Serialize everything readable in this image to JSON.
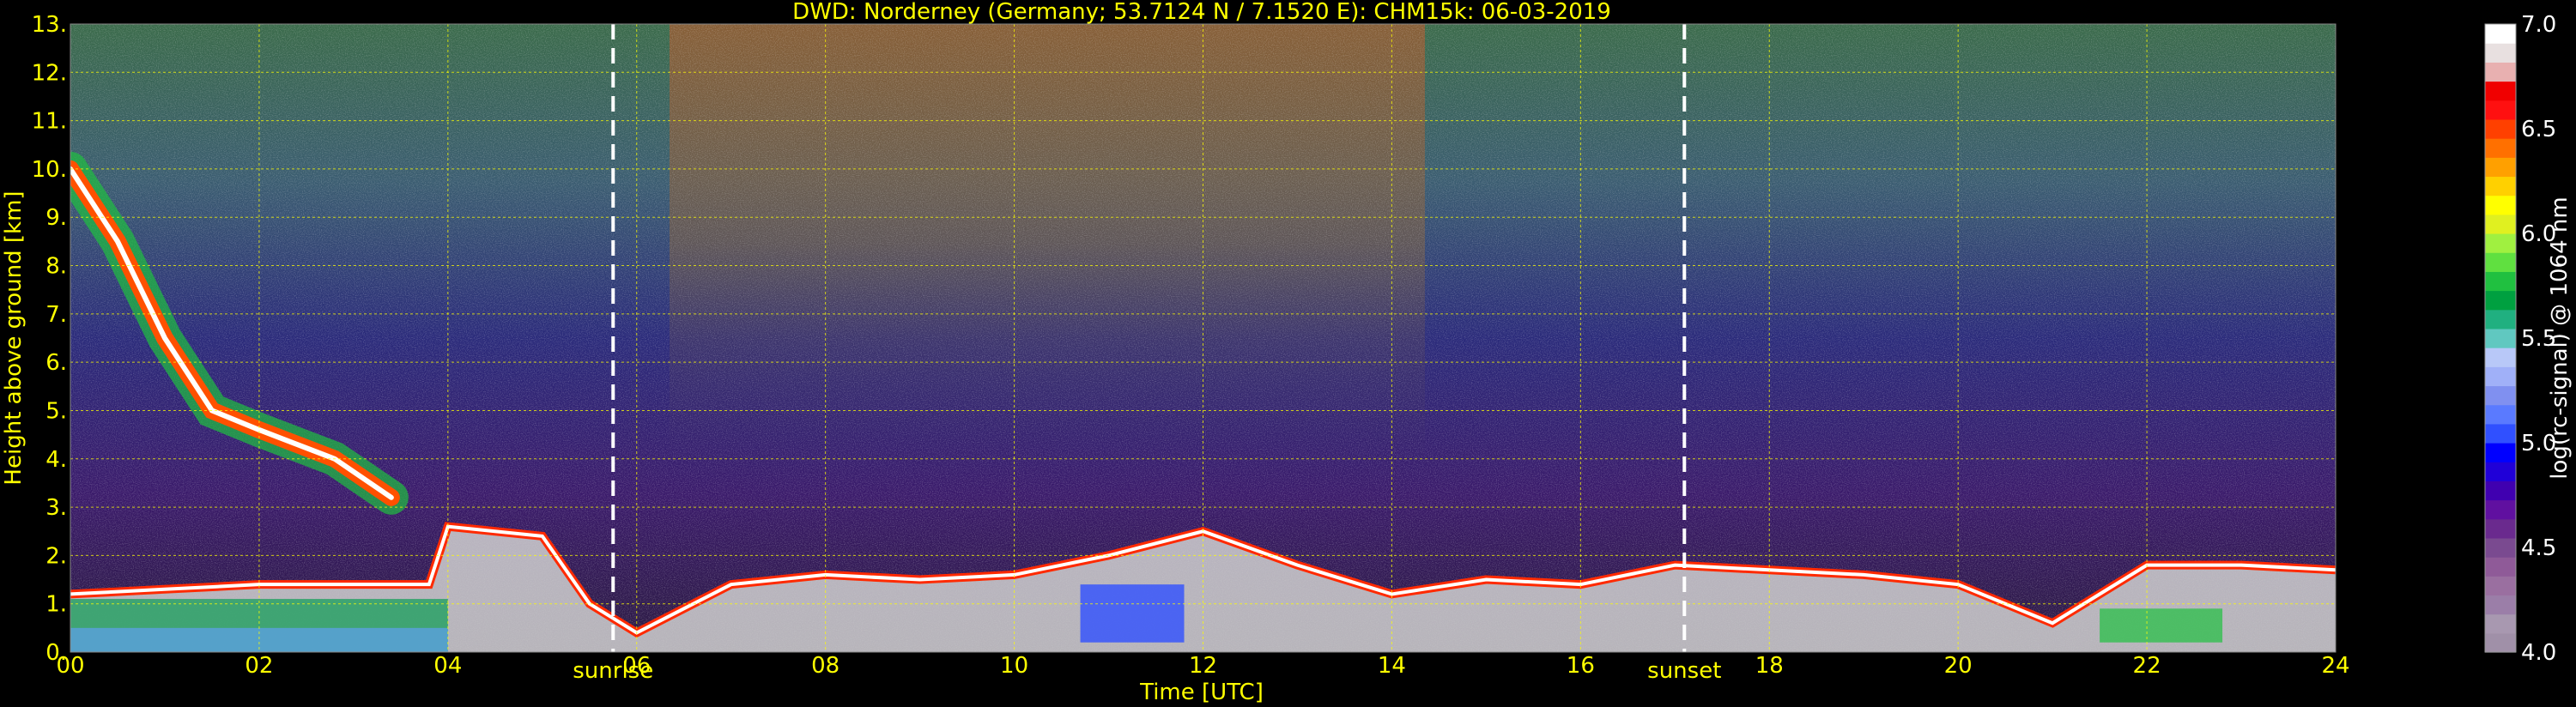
{
  "chart_data": {
    "type": "heatmap",
    "title": "DWD: Norderney (Germany; 53.7124 N / 7.1520 E):    CHM15k: 06-03-2019",
    "xlabel": "Time [UTC]",
    "ylabel": "Height above ground [km]",
    "xlim": [
      0,
      24
    ],
    "ylim": [
      0,
      13
    ],
    "x_ticks": [
      "00",
      "02",
      "04",
      "06",
      "08",
      "10",
      "12",
      "14",
      "16",
      "18",
      "20",
      "22",
      "24"
    ],
    "y_ticks": [
      "0.",
      "1.",
      "2.",
      "3.",
      "4.",
      "5.",
      "6.",
      "7.",
      "8.",
      "9.",
      "10.",
      "11.",
      "12.",
      "13."
    ],
    "grid": true,
    "markers": [
      {
        "label": "sunrise",
        "x": 5.75
      },
      {
        "label": "sunset",
        "x": 17.1
      }
    ],
    "colorbar": {
      "label": "log(rc-signal) @ 1064 nm",
      "range": [
        4.0,
        7.0
      ],
      "ticks": [
        "4.0",
        "4.5",
        "5.0",
        "5.5",
        "6.0",
        "6.5",
        "7.0"
      ],
      "colors": [
        "#a090a8",
        "#a898b0",
        "#9b7ea8",
        "#9a6fa0",
        "#8f5a98",
        "#7a4a90",
        "#6a2a8e",
        "#6010a0",
        "#4000b0",
        "#2000d8",
        "#0000ff",
        "#3050ff",
        "#5a7aff",
        "#8090f0",
        "#a0b0f8",
        "#b8c8f8",
        "#60c8c0",
        "#20b080",
        "#00a040",
        "#20c040",
        "#60e040",
        "#a0f040",
        "#e0f020",
        "#ffff00",
        "#ffd000",
        "#ffa000",
        "#ff7000",
        "#ff4000",
        "#ff1010",
        "#f00000",
        "#e8b0b0",
        "#e8e0e0",
        "#ffffff"
      ]
    },
    "layers": [
      {
        "name": "boundary-layer",
        "points": [
          [
            0,
            1.2
          ],
          [
            1,
            1.3
          ],
          [
            2,
            1.4
          ],
          [
            3,
            1.4
          ],
          [
            3.8,
            1.4
          ],
          [
            4,
            2.6
          ],
          [
            5,
            2.4
          ],
          [
            5.5,
            1.0
          ],
          [
            6,
            0.4
          ],
          [
            7,
            1.4
          ],
          [
            8,
            1.6
          ],
          [
            9,
            1.5
          ],
          [
            10,
            1.6
          ],
          [
            11,
            2.0
          ],
          [
            12,
            2.5
          ],
          [
            13,
            1.8
          ],
          [
            14,
            1.2
          ],
          [
            15,
            1.5
          ],
          [
            16,
            1.4
          ],
          [
            17,
            1.8
          ],
          [
            18,
            1.7
          ],
          [
            19,
            1.6
          ],
          [
            20,
            1.4
          ],
          [
            21,
            0.6
          ],
          [
            22,
            1.8
          ],
          [
            23,
            1.8
          ],
          [
            24,
            1.7
          ]
        ]
      },
      {
        "name": "descending-cloud",
        "points": [
          [
            0,
            10.0
          ],
          [
            0.5,
            8.5
          ],
          [
            1,
            6.5
          ],
          [
            1.5,
            5.0
          ],
          [
            2,
            4.6
          ],
          [
            2.8,
            4.0
          ],
          [
            3.4,
            3.2
          ]
        ]
      }
    ]
  }
}
